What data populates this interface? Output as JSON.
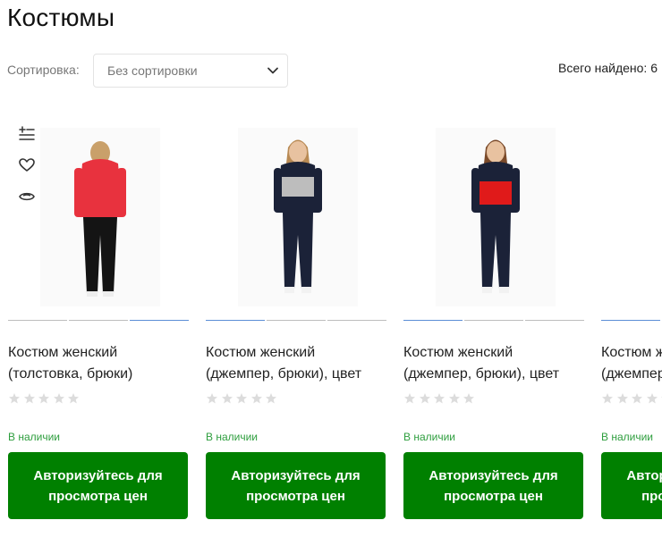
{
  "page": {
    "title": "Костюмы"
  },
  "toolbar": {
    "sort_label": "Сортировка:",
    "sort_value": "Без сортировки",
    "total_found": "Всего найдено: 6"
  },
  "quick_actions": [
    {
      "icon": "compare-icon"
    },
    {
      "icon": "heart-icon"
    },
    {
      "icon": "eye-icon"
    }
  ],
  "products": [
    {
      "name": "Костюм женский (толстовка, брюки)",
      "rating": 0,
      "stock": "В наличии",
      "cta": "Авторизуйтесь для просмотра цен",
      "image": "woman-red-hoodie-back-view",
      "active_dot": 2
    },
    {
      "name": "Костюм женский (джемпер, брюки), цвет",
      "rating": 0,
      "stock": "В наличии",
      "cta": "Авторизуйтесь для просмотра цен",
      "image": "woman-navy-gray-sweater",
      "active_dot": 0
    },
    {
      "name": "Костюм женский (джемпер, брюки), цвет",
      "rating": 0,
      "stock": "В наличии",
      "cta": "Авторизуйтесь для просмотра цен",
      "image": "woman-navy-red-sweater",
      "active_dot": 0
    },
    {
      "name": "Костюм женский (джемпер, брюки), цвет",
      "rating": 0,
      "stock": "В наличии",
      "cta": "Авторизуйтесь для просмотра цен",
      "image": "woman-product-photo",
      "active_dot": 0
    }
  ],
  "colors": {
    "cta_green": "#008000",
    "stock_green": "#2e9e3e",
    "star_gray": "#dcdcdc",
    "active_dot": "#5b8ed6"
  }
}
